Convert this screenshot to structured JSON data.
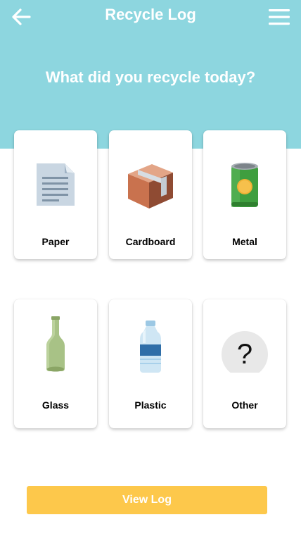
{
  "header": {
    "title": "Recycle Log",
    "back_icon": "arrow-left-icon",
    "menu_icon": "hamburger-menu-icon"
  },
  "prompt": "What did you recycle today?",
  "categories": [
    {
      "label": "Paper",
      "icon": "paper-document-icon"
    },
    {
      "label": "Cardboard",
      "icon": "cardboard-box-icon"
    },
    {
      "label": "Metal",
      "icon": "metal-can-icon"
    },
    {
      "label": "Glass",
      "icon": "glass-bottle-icon"
    },
    {
      "label": "Plastic",
      "icon": "plastic-bottle-icon"
    },
    {
      "label": "Other",
      "icon": "question-mark-icon"
    }
  ],
  "footer": {
    "view_log_label": "View Log"
  },
  "colors": {
    "header_background": "#8dd6df",
    "button_background": "#fdc84b",
    "card_background": "#ffffff",
    "text_on_accent": "#ffffff"
  }
}
